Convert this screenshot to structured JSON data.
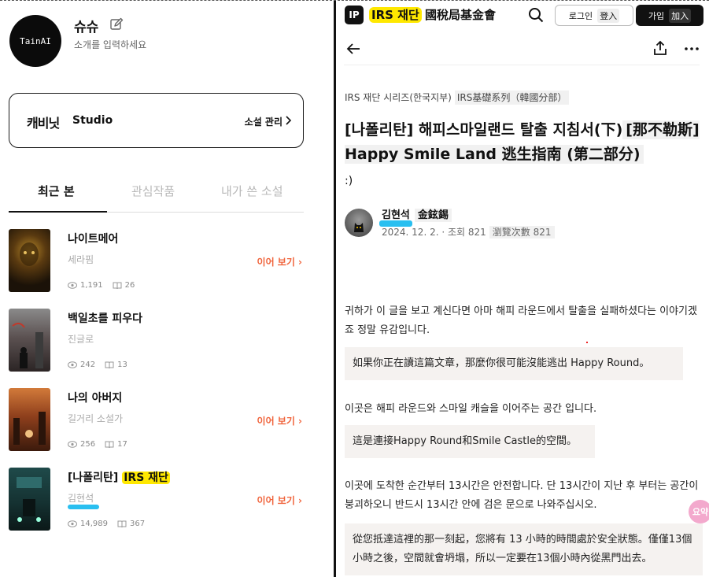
{
  "profile": {
    "avatar_text": "TainAI",
    "name": "슈슈",
    "bio": "소개를 입력하세요"
  },
  "studio": {
    "logo": "캐비닛",
    "label": "Studio",
    "manage_label": "소설 관리"
  },
  "tabs": [
    "최근 본",
    "관심작품",
    "내가 쓴 소설"
  ],
  "novels": [
    {
      "title": "나이트메어",
      "author": "세라핌",
      "views": "1,191",
      "chapters": "26",
      "continue": ""
    },
    {
      "title": "백일초를 피우다",
      "author": "진글로",
      "views": "242",
      "chapters": "13",
      "continue": ""
    },
    {
      "title": "나의 아버지",
      "author": "길거리 소설가",
      "views": "256",
      "chapters": "17",
      "continue": "이어 보기"
    },
    {
      "title_prefix": "[나폴리탄] ",
      "title_hl": "IRS 재단",
      "author": "김현석",
      "views": "14,989",
      "chapters": "367",
      "continue": "이어 보기"
    }
  ],
  "novel_continue_first": "이어 보기",
  "header": {
    "logo_text": "IP",
    "brand": "IRS 재단",
    "brand_cn": "國稅局基金會",
    "login": "로그인",
    "login_cn": "登入",
    "signup": "가입",
    "signup_cn": "加入"
  },
  "post": {
    "series": "IRS 재단 시리즈(한국지부)",
    "series_cn": "IRS基礎系列（韓國分部）",
    "title_ko": "[나폴리탄] 해피스마일랜드 탈출 지침서(下)",
    "title_cn_1": "[那不勒斯] Happy Smile Land 逃生指南 (第二部分)",
    "emoticon": ":)",
    "author": "김현석",
    "author_cn": "金鉉錫",
    "meta": "2024. 12. 2. · 조회 821",
    "meta_cn": "瀏覽次數 821",
    "p1": "귀하가 이 글을 보고 계신다면 아마 해피 라운드에서 탈출을 실패하셨다는 이야기겠죠 정말 유감입니다.",
    "p1_cn": "如果你正在讀這篇文章，那麼你很可能沒能逃出 Happy Round。",
    "p2": "이곳은 해피 라운드와 스마일 캐슬을 이어주는 공간 입니다.",
    "p2_cn": "這是連接Happy Round和Smile Castle的空間。",
    "p3": "이곳에 도착한 순간부터 13시간은 안전합니다. 단 13시간이 지난 후 부터는 공간이 붕괴하오니 반드시 13시간 안에 검은 문으로 나와주십시오.",
    "p3_cn": "從您抵達這裡的那一刻起，您將有 13 小時的時間處於安全狀態。僅僅13個小時之後，空間就會坍塌，所以一定要在13個小時內從黑門出去。",
    "chip": "요약"
  }
}
